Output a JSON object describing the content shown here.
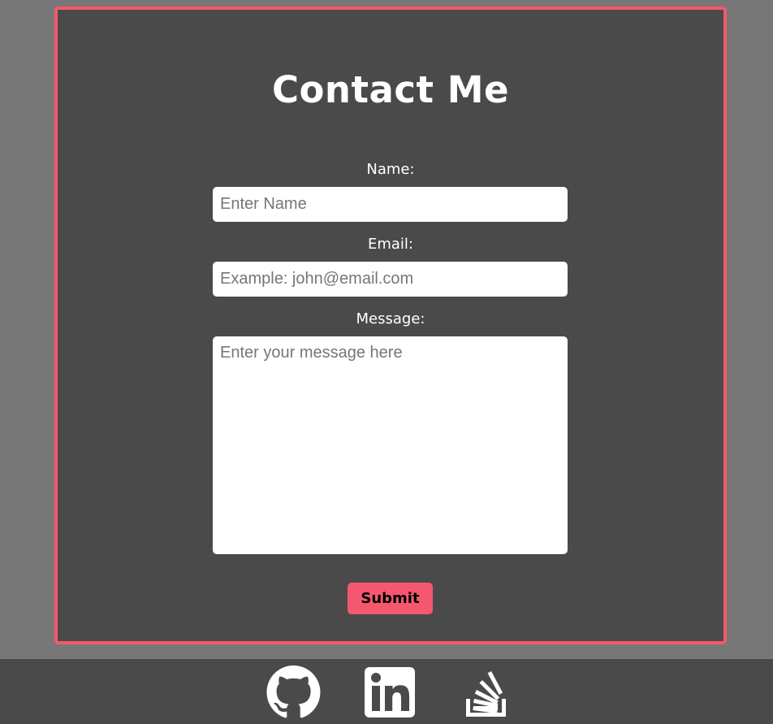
{
  "contact": {
    "title": "Contact Me",
    "name_label": "Name:",
    "name_placeholder": "Enter Name",
    "email_label": "Email:",
    "email_placeholder": "Example: john@email.com",
    "message_label": "Message:",
    "message_placeholder": "Enter your message here",
    "submit_label": "Submit"
  },
  "footer": {
    "links": [
      {
        "icon": "github-icon"
      },
      {
        "icon": "linkedin-icon"
      },
      {
        "icon": "stackoverflow-icon"
      }
    ]
  },
  "colors": {
    "page_background": "#787778",
    "card_background": "#4a4a4a",
    "accent": "#f5586e",
    "text": "#ffffff"
  }
}
